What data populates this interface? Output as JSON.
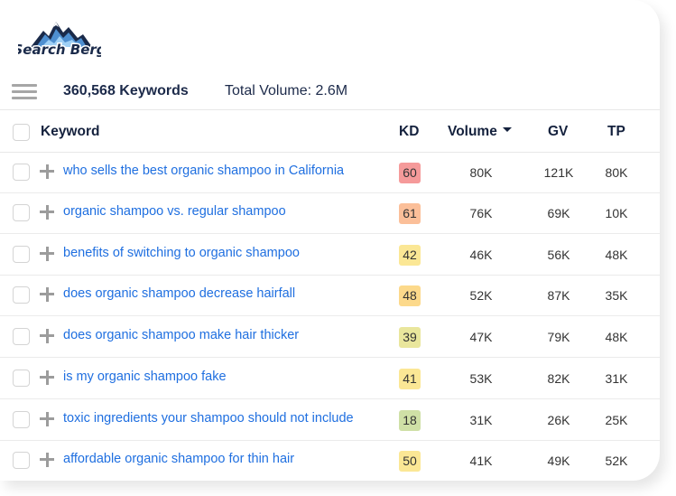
{
  "brand": {
    "name": "Search Berg",
    "colors": {
      "dark": "#1a2a4a",
      "light": "#6cb4ec"
    }
  },
  "summary": {
    "keywords_count": "360,568 Keywords",
    "total_volume": "Total Volume: 2.6M"
  },
  "table": {
    "headers": {
      "keyword": "Keyword",
      "kd": "KD",
      "volume": "Volume",
      "gv": "GV",
      "tp": "TP"
    },
    "sort": {
      "column": "volume",
      "direction": "desc"
    },
    "rows": [
      {
        "keyword": "who sells the best organic shampoo in California",
        "kd": "60",
        "kd_color": "#f59a9a",
        "volume": "80K",
        "gv": "121K",
        "tp": "80K"
      },
      {
        "keyword": "organic shampoo vs. regular shampoo",
        "kd": "61",
        "kd_color": "#fbbf99",
        "volume": "76K",
        "gv": "69K",
        "tp": "10K"
      },
      {
        "keyword": "benefits of switching to organic shampoo",
        "kd": "42",
        "kd_color": "#fbe795",
        "volume": "46K",
        "gv": "56K",
        "tp": "48K"
      },
      {
        "keyword": "does organic shampoo decrease hairfall",
        "kd": "48",
        "kd_color": "#fcd98b",
        "volume": "52K",
        "gv": "87K",
        "tp": "35K"
      },
      {
        "keyword": "does organic shampoo make hair thicker",
        "kd": "39",
        "kd_color": "#e9e69c",
        "volume": "47K",
        "gv": "79K",
        "tp": "48K"
      },
      {
        "keyword": "is my organic shampoo fake",
        "kd": "41",
        "kd_color": "#fbe795",
        "volume": "53K",
        "gv": "82K",
        "tp": "31K"
      },
      {
        "keyword": "toxic ingredients your shampoo should not include",
        "kd": "18",
        "kd_color": "#cfe0a6",
        "volume": "31K",
        "gv": "26K",
        "tp": "25K"
      },
      {
        "keyword": "affordable organic shampoo for thin hair",
        "kd": "50",
        "kd_color": "#fbe795",
        "volume": "41K",
        "gv": "49K",
        "tp": "52K"
      }
    ]
  }
}
